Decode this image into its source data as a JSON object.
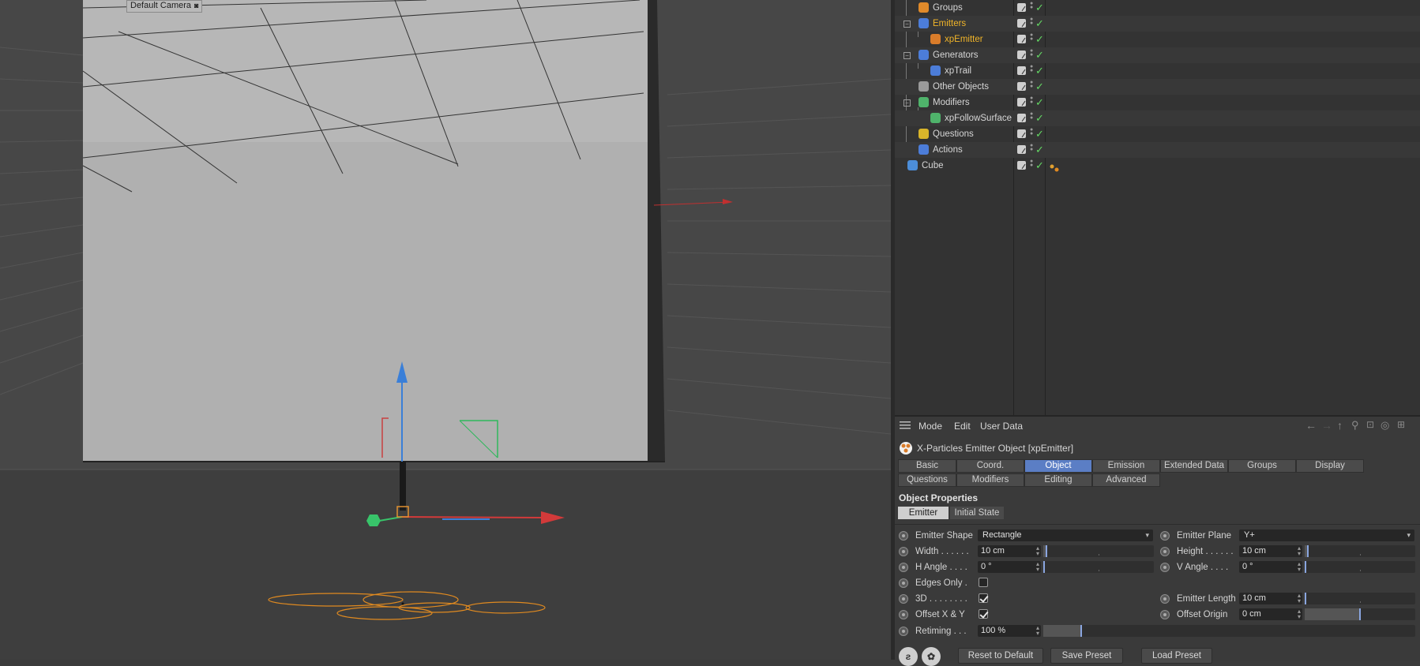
{
  "viewport": {
    "camera_label": "Default Camera"
  },
  "object_manager": {
    "rows": [
      {
        "name": "Groups",
        "icon": "groups-icon",
        "icon_color": "#e08a2a",
        "indent": 1,
        "selected": false
      },
      {
        "name": "Emitters",
        "icon": "emitters-folder-icon",
        "icon_color": "#4c7dd9",
        "indent": 1,
        "selected": true
      },
      {
        "name": "xpEmitter",
        "icon": "xpemitter-icon",
        "icon_color": "#d97c2a",
        "indent": 2,
        "selected": true
      },
      {
        "name": "Generators",
        "icon": "generators-folder-icon",
        "icon_color": "#4c7dd9",
        "indent": 1,
        "selected": false
      },
      {
        "name": "xpTrail",
        "icon": "xptrail-icon",
        "icon_color": "#4c7dd9",
        "indent": 2,
        "selected": false
      },
      {
        "name": "Other Objects",
        "icon": "other-objects-icon",
        "icon_color": "#9a9a9a",
        "indent": 1,
        "selected": false
      },
      {
        "name": "Modifiers",
        "icon": "modifiers-folder-icon",
        "icon_color": "#4fb36b",
        "indent": 1,
        "selected": false
      },
      {
        "name": "xpFollowSurface",
        "icon": "xpfollowsurface-icon",
        "icon_color": "#4fb36b",
        "indent": 2,
        "selected": false
      },
      {
        "name": "Questions",
        "icon": "questions-icon",
        "icon_color": "#d9b52a",
        "indent": 1,
        "selected": false
      },
      {
        "name": "Actions",
        "icon": "actions-folder-icon",
        "icon_color": "#4c7dd9",
        "indent": 1,
        "selected": false
      },
      {
        "name": "Cube",
        "icon": "cube-icon",
        "icon_color": "#4c8ed9",
        "indent": 0,
        "selected": false
      }
    ]
  },
  "attributes": {
    "menu": {
      "mode": "Mode",
      "edit": "Edit",
      "user_data": "User Data"
    },
    "title": "X-Particles Emitter Object [xpEmitter]",
    "tabs_row1": [
      "Basic",
      "Coord.",
      "Object",
      "Emission",
      "Extended Data",
      "Groups",
      "Display"
    ],
    "tabs_row2": [
      "Questions",
      "Modifiers",
      "Editing",
      "Advanced"
    ],
    "active_tab": "Object",
    "section_title": "Object Properties",
    "subtabs": {
      "emitter": "Emitter",
      "initial_state": "Initial State"
    },
    "props": {
      "emitter_shape": {
        "label": "Emitter Shape",
        "value": "Rectangle"
      },
      "emitter_plane": {
        "label": "Emitter Plane",
        "value": "Y+"
      },
      "width": {
        "label": "Width",
        "value": "10 cm",
        "slider": 0.02
      },
      "height": {
        "label": "Height",
        "value": "10 cm",
        "slider": 0.02
      },
      "h_angle": {
        "label": "H Angle",
        "value": "0 °",
        "slider": 0.0
      },
      "v_angle": {
        "label": "V Angle",
        "value": "0 °",
        "slider": 0.0
      },
      "edges_only": {
        "label": "Edges Only",
        "checked": false
      },
      "three_d": {
        "label": "3D",
        "checked": true
      },
      "emitter_length": {
        "label": "Emitter Length",
        "value": "10 cm",
        "slider": 0.0
      },
      "offset_xy": {
        "label": "Offset X & Y",
        "checked": true
      },
      "offset_origin": {
        "label": "Offset Origin",
        "value": "0 cm",
        "slider": 0.5
      },
      "retiming": {
        "label": "Retiming",
        "value": "100 %",
        "slider": 0.1
      }
    },
    "buttons": {
      "reset": "Reset to Default",
      "save": "Save Preset",
      "load": "Load Preset"
    }
  }
}
